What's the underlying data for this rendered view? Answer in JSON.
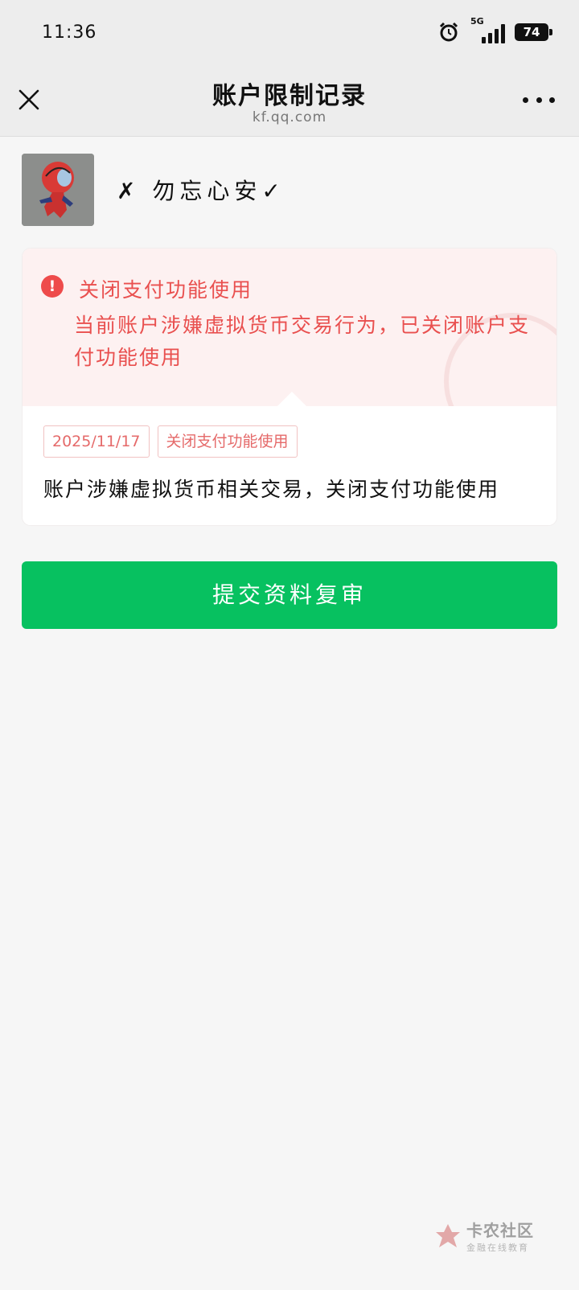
{
  "status_bar": {
    "time": "11:36",
    "network": "5G",
    "battery": "74",
    "icons": [
      "alarm-icon",
      "signal-icon",
      "battery-icon"
    ]
  },
  "nav": {
    "title": "账户限制记录",
    "subtitle": "kf.qq.com",
    "close_icon": "close-icon",
    "more_icon": "more-dots-icon"
  },
  "user": {
    "name": "✗ 勿忘心安✓"
  },
  "notice": {
    "icon": "exclamation-icon",
    "title": "关闭支付功能使用",
    "description": "当前账户涉嫌虚拟货币交易行为，已关闭账户支付功能使用",
    "tags": [
      "2025/11/17",
      "关闭支付功能使用"
    ],
    "detail": "账户涉嫌虚拟货币相关交易，关闭支付功能使用",
    "colors": {
      "alert": "#e9504f",
      "alert_bg": "#fdf1f1"
    }
  },
  "actions": {
    "submit_label": "提交资料复审",
    "submit_color": "#07c160"
  },
  "watermark": {
    "name": "卡农社区",
    "sub": "金融在线教育"
  }
}
